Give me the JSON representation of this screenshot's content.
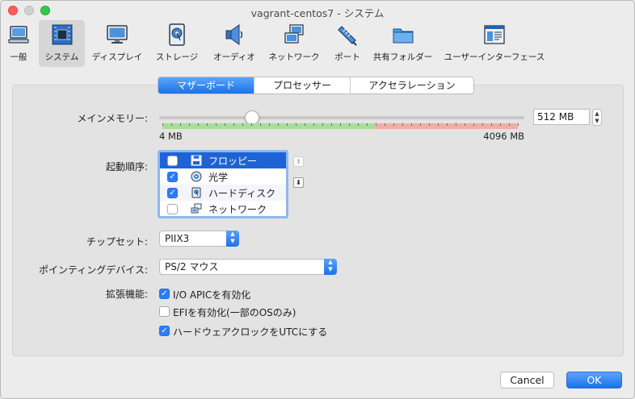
{
  "window": {
    "title": "vagrant-centos7 - システム"
  },
  "toolbar": {
    "items": [
      {
        "label": "一般",
        "icon": "general-icon"
      },
      {
        "label": "システム",
        "icon": "system-chip-icon"
      },
      {
        "label": "ディスプレイ",
        "icon": "display-icon"
      },
      {
        "label": "ストレージ",
        "icon": "storage-disk-icon"
      },
      {
        "label": "オーディオ",
        "icon": "audio-speaker-icon"
      },
      {
        "label": "ネットワーク",
        "icon": "network-icon"
      },
      {
        "label": "ポート",
        "icon": "port-icon"
      },
      {
        "label": "共有フォルダー",
        "icon": "shared-folder-icon"
      },
      {
        "label": "ユーザーインターフェース",
        "icon": "user-interface-icon"
      }
    ],
    "active": "システム"
  },
  "tabs": {
    "motherboard": "マザーボード",
    "processor": "プロセッサー",
    "acceleration": "アクセラレーション",
    "selected": "マザーボード"
  },
  "memory": {
    "label": "メインメモリー:",
    "value": "512",
    "unit": "MB",
    "display": "512 MB",
    "min_label": "4 MB",
    "max_label": "4096 MB",
    "min": 4,
    "max": 4096,
    "current": 512
  },
  "boot_order": {
    "label": "起動順序:",
    "items": [
      {
        "label": "フロッピー",
        "checked": false,
        "icon": "floppy-icon"
      },
      {
        "label": "光学",
        "checked": true,
        "icon": "optical-disc-icon"
      },
      {
        "label": "ハードディスク",
        "checked": true,
        "icon": "hard-disk-icon"
      },
      {
        "label": "ネットワーク",
        "checked": false,
        "icon": "network-icon"
      }
    ],
    "selected_index": 0
  },
  "chipset": {
    "label": "チップセット:",
    "value": "PIIX3"
  },
  "pointing": {
    "label": "ポインティングデバイス:",
    "value": "PS/2 マウス"
  },
  "extended": {
    "label": "拡張機能:",
    "options": [
      {
        "label": "I/O APICを有効化",
        "checked": true
      },
      {
        "label": "EFIを有効化(一部のOSのみ)",
        "checked": false
      },
      {
        "label": "ハードウェアクロックをUTCにする",
        "checked": true
      }
    ]
  },
  "buttons": {
    "cancel": "Cancel",
    "ok": "OK"
  },
  "colors": {
    "accent": "#1a73e8",
    "slider_green": "#a8dd9a",
    "slider_red": "#efaea6",
    "list_selection": "#1e63d4"
  }
}
